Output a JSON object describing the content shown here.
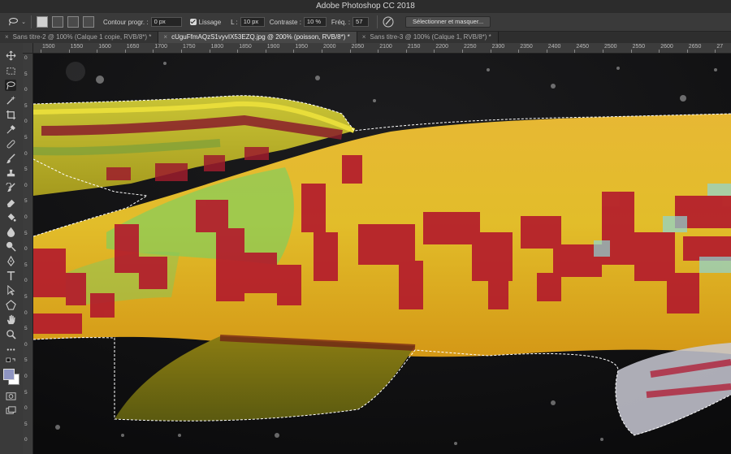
{
  "window": {
    "title": "Adobe Photoshop CC 2018"
  },
  "options_bar": {
    "feather_label": "Contour progr. :",
    "feather_value": "0 px",
    "antialias_label": "Lissage",
    "width_label": "L :",
    "width_value": "10 px",
    "contrast_label": "Contraste :",
    "contrast_value": "10 %",
    "frequency_label": "Fréq. :",
    "frequency_value": "57",
    "select_mask_label": "Sélectionner et masquer..."
  },
  "tabs": [
    {
      "label": "Sans titre-2 @ 100% (Calque 1 copie, RVB/8*) *",
      "active": false
    },
    {
      "label": "cUguFfmAQzS1vyvIX53EZQ.jpg @ 200% (poisson, RVB/8*) *",
      "active": true
    },
    {
      "label": "Sans titre-3 @ 100% (Calque 1, RVB/8*) *",
      "active": false
    }
  ],
  "ruler_top": [
    "1500",
    "1550",
    "1600",
    "1650",
    "1700",
    "1750",
    "1800",
    "1850",
    "1900",
    "1950",
    "2000",
    "2050",
    "2100",
    "2150",
    "2200",
    "2250",
    "2300",
    "2350",
    "2400",
    "2450",
    "2500",
    "2550",
    "2600",
    "2650",
    "27"
  ],
  "ruler_left": [
    "0",
    "5",
    "0",
    "5",
    "0",
    "5",
    "0",
    "5",
    "0",
    "5",
    "0",
    "5",
    "0",
    "5",
    "0",
    "5",
    "0",
    "5",
    "0",
    "5",
    "0",
    "5",
    "0",
    "5",
    "0"
  ],
  "tools": [
    "move-tool",
    "marquee-tool",
    "magnetic-lasso-tool",
    "quick-selection-tool",
    "crop-tool",
    "eyedropper-tool",
    "healing-brush-tool",
    "brush-tool",
    "clone-stamp-tool",
    "history-brush-tool",
    "eraser-tool",
    "paint-bucket-tool",
    "blur-tool",
    "dodge-tool",
    "pen-tool",
    "type-tool",
    "path-selection-tool",
    "shape-tool",
    "hand-tool",
    "zoom-tool",
    "more-tools",
    "default-colors",
    "quick-mask",
    "screen-mode"
  ],
  "colors": {
    "foreground": "#8f95c2",
    "background": "#ffffff"
  }
}
